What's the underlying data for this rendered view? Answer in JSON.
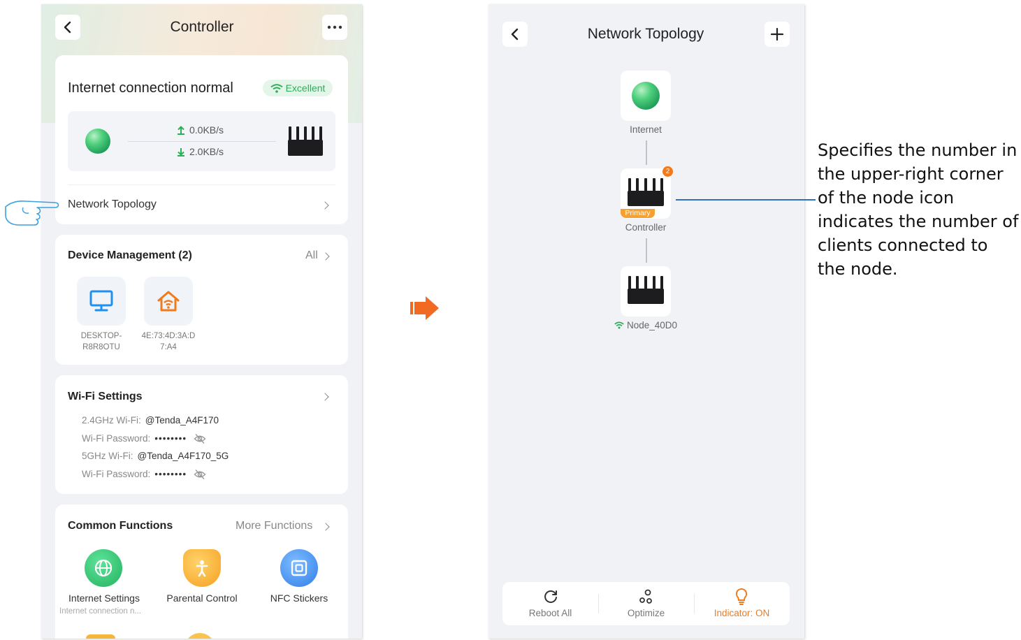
{
  "left_screen": {
    "title": "Controller",
    "internet_status": "Internet connection normal",
    "signal_badge": "Excellent",
    "upload_speed": "0.0KB/s",
    "download_speed": "2.0KB/s",
    "network_topology_label": "Network Topology",
    "device_management": {
      "title": "Device Management (2)",
      "all_label": "All",
      "devices": [
        {
          "line1": "DESKTOP-",
          "line2": "R8R8OTU",
          "icon": "desktop-icon"
        },
        {
          "line1": "4E:73:4D:3A:D",
          "line2": "7:A4",
          "icon": "smart-home-icon"
        }
      ]
    },
    "wifi_settings": {
      "title": "Wi-Fi Settings",
      "rows": [
        {
          "label": "2.4GHz Wi-Fi:",
          "value": "@Tenda_A4F170"
        },
        {
          "label": "Wi-Fi Password:",
          "value": "••••••••"
        },
        {
          "label": "5GHz Wi-Fi:",
          "value": "@Tenda_A4F170_5G"
        },
        {
          "label": "Wi-Fi Password:",
          "value": "••••••••"
        }
      ]
    },
    "common_functions": {
      "title": "Common Functions",
      "more_label": "More Functions",
      "items": [
        {
          "label": "Internet Settings",
          "sub": "Internet connection n...",
          "color": "#2fc06d"
        },
        {
          "label": "Parental Control",
          "sub": "",
          "color": "#f5a623"
        },
        {
          "label": "NFC Stickers",
          "sub": "",
          "color": "#3b8cf0"
        }
      ]
    }
  },
  "right_screen": {
    "title": "Network Topology",
    "nodes": {
      "internet_label": "Internet",
      "controller_label": "Controller",
      "controller_badge": "2",
      "primary_tag": "Primary",
      "node_label": "Node_40D0"
    },
    "bottom_bar": {
      "reboot_label": "Reboot All",
      "optimize_label": "Optimize",
      "indicator_label": "Indicator: ON"
    }
  },
  "annotation": "Specifies the number in the upper-right corner of the node icon indicates the number of clients connected to the node.",
  "colors": {
    "accent_green": "#2cae59",
    "accent_orange": "#f07a1e",
    "arrow_orange": "#f26a22",
    "annotation_line": "#2f6fbd"
  }
}
